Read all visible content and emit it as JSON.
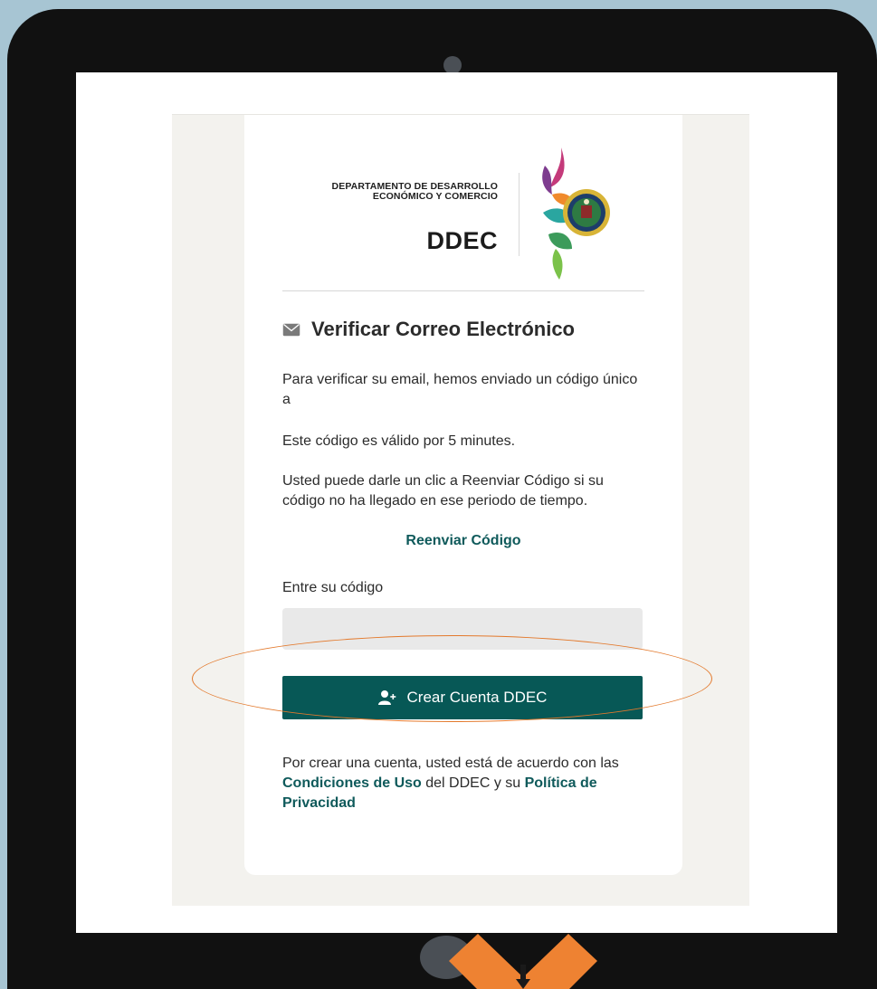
{
  "header": {
    "dept_line1": "DEPARTAMENTO DE DESARROLLO",
    "dept_line2": "ECONÓMICO Y COMERCIO",
    "brand": "DDEC"
  },
  "verify": {
    "title": "Verificar Correo Electrónico",
    "para1": "Para verificar su email, hemos enviado un código único a",
    "para2": "Este código es válido por 5 minutes.",
    "para3": "Usted puede darle un clic a Reenviar Código si su código no ha llegado en ese periodo de tiempo.",
    "resend_label": "Reenviar Código",
    "code_label": "Entre su código",
    "code_value": "",
    "create_button": "Crear Cuenta DDEC"
  },
  "terms": {
    "prefix": "Por crear una cuenta, usted está de acuerdo con las ",
    "terms_link": "Condiciones de Uso",
    "middle": " del DDEC y su ",
    "privacy_link": "Política de Privacidad"
  },
  "colors": {
    "accent": "#075856",
    "link": "#0f5a5b",
    "annotation": "#e3792c",
    "background": "#a7c5d3",
    "device": "#111111"
  },
  "icons": {
    "title_icon": "envelope-icon",
    "button_icon": "user-plus-icon"
  }
}
